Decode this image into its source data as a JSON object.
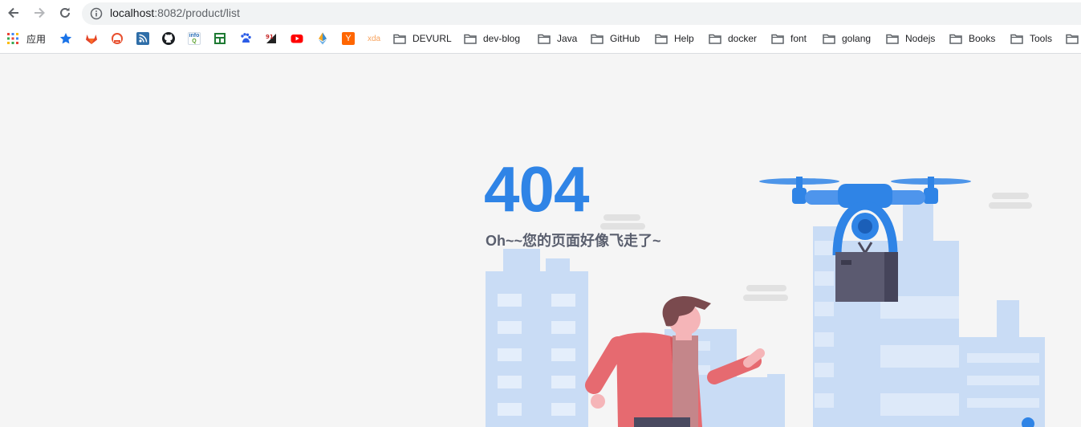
{
  "browser": {
    "url_host": "localhost",
    "url_path": ":8082/product/list",
    "bookmarks_bar": {
      "apps_label": "应用",
      "favicons": [
        "star-icon",
        "gitlab-icon",
        "cloud-icon",
        "feed-icon",
        "github-icon",
        "infoq-icon",
        "store-icon",
        "baidu-icon",
        "ninety-one-icon",
        "youtube-icon",
        "ethereum-icon",
        "ycombinator-icon",
        "xda-icon"
      ],
      "ycombinator_glyph": "Y",
      "xda_glyph": "xda",
      "folders": [
        "DEVURL",
        "dev-blog",
        "Java",
        "GitHub",
        "Help",
        "docker",
        "font",
        "golang",
        "Nodejs",
        "Books",
        "Tools"
      ]
    }
  },
  "page": {
    "code": "404",
    "message": "Oh~~您的页面好像飞走了~"
  },
  "colors": {
    "accent": "#2f84e6",
    "building": "#c9dcf5",
    "text_muted": "#5a5f6e",
    "background": "#f5f5f5"
  }
}
